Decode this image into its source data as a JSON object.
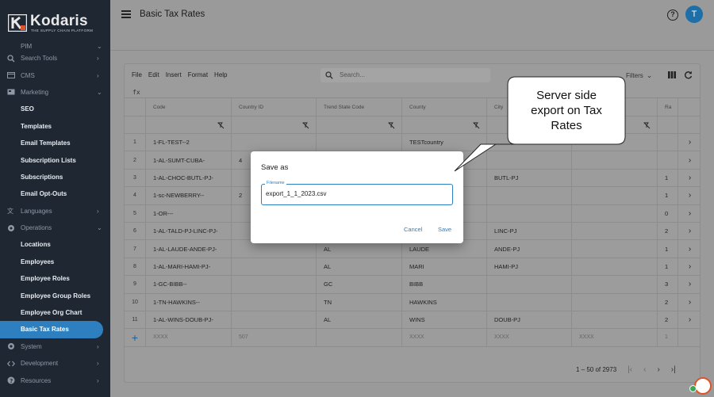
{
  "brand": {
    "name": "Kodaris",
    "tagline": "THE SUPPLY CHAIN PLATFORM"
  },
  "sidebar": {
    "top_cut": {
      "label": "PIM"
    },
    "items": [
      {
        "label": "Search Tools",
        "icon": "search-icon",
        "chevron": ">"
      },
      {
        "label": "CMS",
        "icon": "cms-icon",
        "chevron": ">"
      },
      {
        "label": "Marketing",
        "icon": "marketing-icon",
        "chevron": "v"
      },
      {
        "label": "SEO",
        "sub": true
      },
      {
        "label": "Templates",
        "sub": true
      },
      {
        "label": "Email Templates",
        "sub": true
      },
      {
        "label": "Subscription Lists",
        "sub": true
      },
      {
        "label": "Subscriptions",
        "sub": true
      },
      {
        "label": "Email Opt-Outs",
        "sub": true
      },
      {
        "label": "Languages",
        "icon": "translate-icon",
        "chevron": ">"
      },
      {
        "label": "Operations",
        "icon": "operations-icon",
        "chevron": "v"
      },
      {
        "label": "Locations",
        "sub": true
      },
      {
        "label": "Employees",
        "sub": true
      },
      {
        "label": "Employee Roles",
        "sub": true
      },
      {
        "label": "Employee Group Roles",
        "sub": true
      },
      {
        "label": "Employee Org Chart",
        "sub": true
      },
      {
        "label": "Basic Tax Rates",
        "sub": true,
        "active": true
      },
      {
        "label": "System",
        "icon": "gear-icon",
        "chevron": ">"
      },
      {
        "label": "Development",
        "icon": "code-icon",
        "chevron": ">"
      },
      {
        "label": "Resources",
        "icon": "help-icon",
        "chevron": ">"
      }
    ]
  },
  "header": {
    "title": "Basic Tax Rates",
    "avatar_initial": "T"
  },
  "grid": {
    "menu": [
      "File",
      "Edit",
      "Insert",
      "Format",
      "Help"
    ],
    "search_placeholder": "Search...",
    "filters_label": "Filters",
    "fx_label": "fx",
    "columns": [
      "Code",
      "Country ID",
      "Trend State Code",
      "County",
      "City",
      "",
      "Ra"
    ],
    "rows": [
      {
        "n": "1",
        "code": "1-FL-TEST--2",
        "country": "",
        "state": "",
        "county": "TESTcountry",
        "city": "",
        "c6": "",
        "rate": ""
      },
      {
        "n": "2",
        "code": "1-AL-SUMT-CUBA-",
        "country": "4",
        "state": "",
        "county": "",
        "city": "",
        "c6": "",
        "rate": ""
      },
      {
        "n": "3",
        "code": "1-AL-CHOC-BUTL-PJ-",
        "country": "",
        "state": "",
        "county": "",
        "city": "BUTL-PJ",
        "c6": "",
        "rate": "1"
      },
      {
        "n": "4",
        "code": "1-sc-NEWBERRY--",
        "country": "2",
        "state": "",
        "county": "",
        "city": "",
        "c6": "",
        "rate": "1"
      },
      {
        "n": "5",
        "code": "1-OR---",
        "country": "",
        "state": "",
        "county": "",
        "city": "",
        "c6": "",
        "rate": "0"
      },
      {
        "n": "6",
        "code": "1-AL-TALD-PJ-LINC-PJ-",
        "country": "",
        "state": "",
        "county": "",
        "city": "LINC-PJ",
        "c6": "",
        "rate": "2"
      },
      {
        "n": "7",
        "code": "1-AL-LAUDE-ANDE-PJ-",
        "country": "",
        "state": "AL",
        "county": "LAUDE",
        "city": "ANDE-PJ",
        "c6": "",
        "rate": "1"
      },
      {
        "n": "8",
        "code": "1-AL-MARI-HAMI-PJ-",
        "country": "",
        "state": "AL",
        "county": "MARI",
        "city": "HAMI-PJ",
        "c6": "",
        "rate": "1"
      },
      {
        "n": "9",
        "code": "1-GC-BIBB--",
        "country": "",
        "state": "GC",
        "county": "BIBB",
        "city": "",
        "c6": "",
        "rate": "3"
      },
      {
        "n": "10",
        "code": "1-TN-HAWKINS--",
        "country": "",
        "state": "TN",
        "county": "HAWKINS",
        "city": "",
        "c6": "",
        "rate": "2"
      },
      {
        "n": "11",
        "code": "1-AL-WINS-DOUB-PJ-",
        "country": "",
        "state": "AL",
        "county": "WINS",
        "city": "DOUB-PJ",
        "c6": "",
        "rate": "2"
      }
    ],
    "new_row": {
      "code": "XXXX",
      "country": "507",
      "state": "",
      "county": "XXXX",
      "city": "XXXX",
      "c6": "XXXX",
      "rate": "1"
    },
    "pager": {
      "range": "1 – 50 of 2973"
    }
  },
  "dialog": {
    "title": "Save as",
    "field_label": "Filename",
    "field_value": "export_1_1_2023.csv",
    "cancel": "Cancel",
    "save": "Save"
  },
  "callout": {
    "text": [
      "Server side",
      "export on Tax",
      "Rates"
    ]
  }
}
